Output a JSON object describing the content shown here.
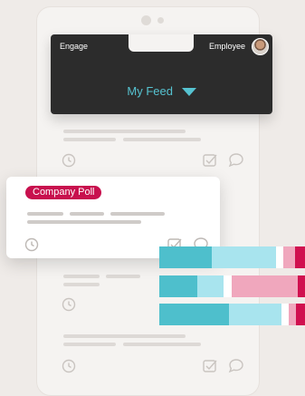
{
  "header": {
    "left_label": "Engage",
    "right_label": "Employee",
    "feed_title": "My Feed"
  },
  "poll_card": {
    "badge_label": "Company Poll"
  },
  "colors": {
    "accent_teal": "#56c3d1",
    "poll_pink": "#c8104e",
    "header_bg": "#2c2c2c"
  },
  "poll_results": [
    {
      "teal": 0.36,
      "light_teal": 0.44,
      "white": 0.05,
      "light_pink": 0.08,
      "pink": 0.07
    },
    {
      "teal": 0.26,
      "light_teal": 0.18,
      "white": 0.06,
      "light_pink": 0.45,
      "pink": 0.05
    },
    {
      "teal": 0.48,
      "light_teal": 0.36,
      "white": 0.05,
      "light_pink": 0.05,
      "pink": 0.06
    }
  ],
  "icons": {
    "clock": "clock-icon",
    "check": "checkbox-icon",
    "comment": "comment-icon",
    "caret": "caret-down-icon"
  }
}
